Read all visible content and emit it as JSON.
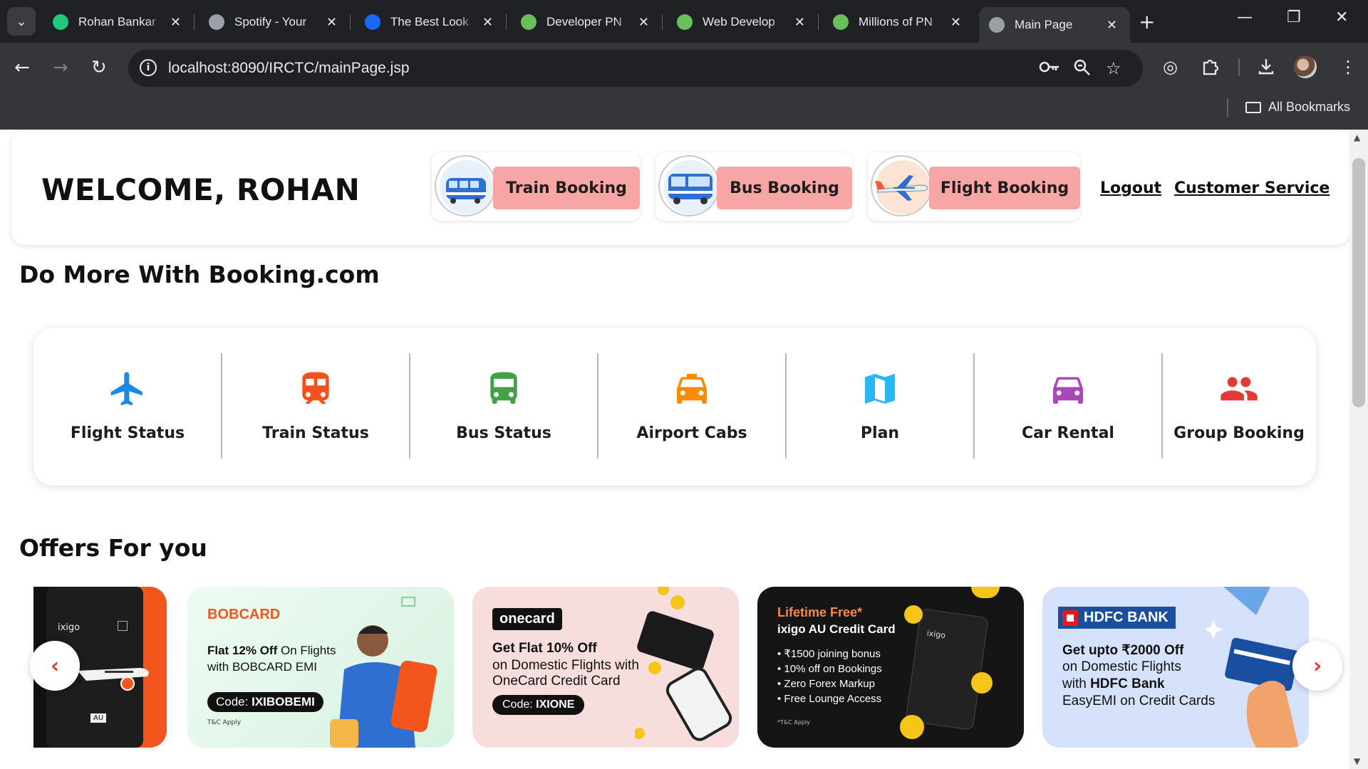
{
  "browser": {
    "tabs": [
      {
        "title": "Rohan Bankar",
        "color": "#21c87a"
      },
      {
        "title": "Spotify - Your",
        "color": "#9aa0a6"
      },
      {
        "title": "The Best Look",
        "color": "#1769ff"
      },
      {
        "title": "Developer PN",
        "color": "#69c05a"
      },
      {
        "title": "Web Develop",
        "color": "#69c05a"
      },
      {
        "title": "Millions of PN",
        "color": "#69c05a"
      },
      {
        "title": "Main Page",
        "color": "#9aa0a6"
      }
    ],
    "url": "localhost:8090/IRCTC/mainPage.jsp",
    "bookmarks_label": "All Bookmarks"
  },
  "header": {
    "welcome": "WELCOME, ROHAN",
    "bookings": [
      {
        "label": "Train Booking",
        "icon": "train-icon"
      },
      {
        "label": "Bus Booking",
        "icon": "bus-icon"
      },
      {
        "label": "Flight Booking",
        "icon": "flight-icon"
      }
    ],
    "logout": "Logout",
    "customer_service": "Customer Service"
  },
  "do_more": {
    "title": "Do More With Booking.com",
    "services": [
      {
        "label": "Flight Status",
        "icon": "airplane-icon",
        "color": "#1e88e5"
      },
      {
        "label": "Train Status",
        "icon": "train-icon",
        "color": "#f4511e"
      },
      {
        "label": "Bus Status",
        "icon": "bus-icon",
        "color": "#43a047"
      },
      {
        "label": "Airport Cabs",
        "icon": "taxi-icon",
        "color": "#fb8c00"
      },
      {
        "label": "Plan",
        "icon": "map-icon",
        "color": "#29b6f6"
      },
      {
        "label": "Car Rental",
        "icon": "car-icon",
        "color": "#ab47bc"
      },
      {
        "label": "Group Booking",
        "icon": "group-icon",
        "color": "#e53935"
      }
    ]
  },
  "offers": {
    "title": "Offers For you",
    "cards": [
      {
        "brand": "ixigo",
        "code_label": "AU"
      },
      {
        "brand": "BOBCARD",
        "headline_bold": "Flat 12% Off",
        "headline_rest": " On Flights",
        "line2": "with BOBCARD EMI",
        "code_label": "Code: ",
        "code": "IXIBOBEMI",
        "tnc": "T&C Apply"
      },
      {
        "brand": "onecard",
        "headline": "Get Flat 10% Off",
        "line2": "on Domestic Flights with",
        "line3": "OneCard Credit Card",
        "code_label": "Code: ",
        "code": "IXIONE"
      },
      {
        "title": "Lifetime Free*",
        "subtitle": "ixigo AU Credit Card",
        "bullets": [
          "• ₹1500 joining bonus",
          "• 10% off on Bookings",
          "• Zero Forex Markup",
          "• Free Lounge Access"
        ],
        "tnc": "*T&C Apply",
        "card_brand": "ixigo"
      },
      {
        "brand": "HDFC BANK",
        "headline": "Get upto ₹2000 Off",
        "line2": "on Domestic Flights",
        "line3_pre": "with ",
        "line3_bold": "HDFC Bank",
        "line4": "EasyEMI on Credit Cards"
      }
    ]
  }
}
